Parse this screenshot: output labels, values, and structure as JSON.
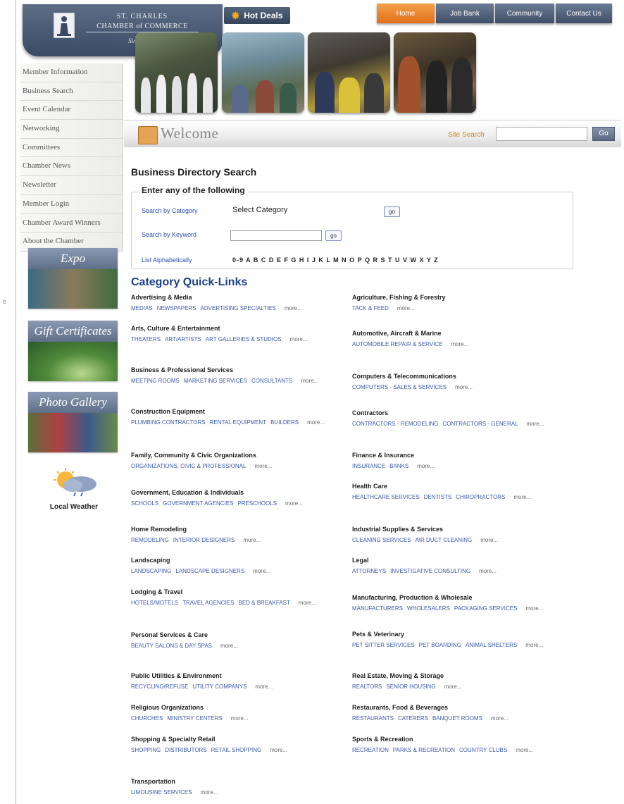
{
  "header": {
    "logo": {
      "line1": "ST. CHARLES",
      "line2": "CHAMBER of COMMERCE",
      "line3": "Since 1988"
    },
    "hot_deals": "Hot Deals",
    "nav": [
      "Home",
      "Job Bank",
      "Community",
      "Contact Us"
    ]
  },
  "sidebar": {
    "menu": [
      "Member Information",
      "Business Search",
      "Event Calendar",
      "Networking",
      "Committees",
      "Chamber News",
      "Newsletter",
      "Member Login",
      "Chamber Award Winners",
      "About the Chamber"
    ],
    "promos": [
      "Expo",
      "Gift Certificates",
      "Photo Gallery"
    ],
    "weather": "Local Weather"
  },
  "welcome": {
    "title": "Welcome",
    "site_search_label": "Site Search",
    "go": "Go"
  },
  "directory": {
    "title": "Business Directory Search",
    "legend": "Enter any of the following",
    "by_category_label": "Search by Category",
    "category_select": "Select Category",
    "by_keyword_label": "Search by Keyword",
    "alpha_label": "List Alphabetically",
    "alpha_letters": "0-9 A B C D E F G H I J K L M N O P Q R S T U V W X Y Z",
    "go": "go"
  },
  "quicklinks": {
    "title": "Category Quick-Links",
    "more": "more...",
    "left": [
      {
        "title": "Advertising & Media",
        "links": [
          "Medias",
          "Newspapers",
          "Advertising Specialties"
        ]
      },
      {
        "title": "Arts, Culture & Entertainment",
        "links": [
          "Theaters",
          "Art/Artists",
          "Art Galleries & Studios"
        ]
      },
      {
        "title": "Business & Professional Services",
        "links": [
          "Meeting Rooms",
          "Marketing Services",
          "Consultants"
        ]
      },
      {
        "title": "Construction Equipment",
        "links": [
          "Plumbing Contractors",
          "Rental Equipment",
          "Builders"
        ]
      },
      {
        "title": "Family, Community & Civic Organizations",
        "links": [
          "Organizations, Civic & Professional"
        ]
      },
      {
        "title": "Government, Education & Individuals",
        "links": [
          "Schools",
          "Government Agencies",
          "Preschools"
        ]
      },
      {
        "title": "Home Remodeling",
        "links": [
          "Remodeling",
          "Interior Designers"
        ]
      },
      {
        "title": "Landscaping",
        "links": [
          "Landscaping",
          "Landscape Designers"
        ]
      },
      {
        "title": "Lodging & Travel",
        "links": [
          "Hotels/Motels",
          "Travel Agencies",
          "Bed & Breakfast"
        ]
      },
      {
        "title": "Personal Services & Care",
        "links": [
          "Beauty Salons & Day Spas"
        ]
      },
      {
        "title": "Public Utilities & Environment",
        "links": [
          "Recycling/Refuse",
          "Utility Companys"
        ]
      },
      {
        "title": "Religious Organizations",
        "links": [
          "Churches",
          "Ministry Centers"
        ]
      },
      {
        "title": "Shopping & Specialty Retail",
        "links": [
          "Shopping",
          "Distributors",
          "Retail Shopping"
        ]
      },
      {
        "title": "Transportation",
        "links": [
          "Limousine Services"
        ]
      }
    ],
    "right": [
      {
        "title": "Agriculture, Fishing & Forestry",
        "links": [
          "Tack & Feed"
        ]
      },
      {
        "title": "Automotive, Aircraft & Marine",
        "links": [
          "Automobile Repair & Service"
        ]
      },
      {
        "title": "Computers & Telecommunications",
        "links": [
          "Computers - Sales & Services"
        ]
      },
      {
        "title": "Contractors",
        "links": [
          "Contractors - Remodeling",
          "Contractors - General"
        ]
      },
      {
        "title": "Finance & Insurance",
        "links": [
          "Insurance",
          "Banks"
        ]
      },
      {
        "title": "Health Care",
        "links": [
          "Healthcare Services",
          "Dentists",
          "Chiropractors"
        ]
      },
      {
        "title": "Industrial Supplies & Services",
        "links": [
          "Cleaning Services",
          "Air Duct Cleaning"
        ]
      },
      {
        "title": "Legal",
        "links": [
          "Attorneys",
          "Investigative Consulting"
        ]
      },
      {
        "title": "Manufacturing, Production & Wholesale",
        "links": [
          "Manufacturers",
          "Wholesalers",
          "Packaging Services"
        ]
      },
      {
        "title": "Pets & Veterinary",
        "links": [
          "Pet Sitter Services",
          "Pet Boarding",
          "Animal Shelters"
        ]
      },
      {
        "title": "Real Estate, Moving & Storage",
        "links": [
          "Realtors",
          "Senior Housing"
        ]
      },
      {
        "title": "Restaurants, Food & Beverages",
        "links": [
          "Restaurants",
          "Caterers",
          "Banquet Rooms"
        ]
      },
      {
        "title": "Sports & Recreation",
        "links": [
          "Recreation",
          "Parks & Recreation",
          "Country Clubs"
        ]
      }
    ]
  }
}
